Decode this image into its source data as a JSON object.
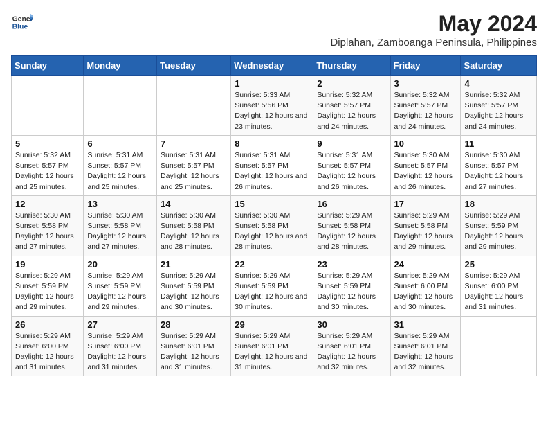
{
  "header": {
    "logo_general": "General",
    "logo_blue": "Blue",
    "month_year": "May 2024",
    "location": "Diplahan, Zamboanga Peninsula, Philippines"
  },
  "weekdays": [
    "Sunday",
    "Monday",
    "Tuesday",
    "Wednesday",
    "Thursday",
    "Friday",
    "Saturday"
  ],
  "weeks": [
    [
      {
        "day": "",
        "sunrise": "",
        "sunset": "",
        "daylight": ""
      },
      {
        "day": "",
        "sunrise": "",
        "sunset": "",
        "daylight": ""
      },
      {
        "day": "",
        "sunrise": "",
        "sunset": "",
        "daylight": ""
      },
      {
        "day": "1",
        "sunrise": "Sunrise: 5:33 AM",
        "sunset": "Sunset: 5:56 PM",
        "daylight": "Daylight: 12 hours and 23 minutes."
      },
      {
        "day": "2",
        "sunrise": "Sunrise: 5:32 AM",
        "sunset": "Sunset: 5:57 PM",
        "daylight": "Daylight: 12 hours and 24 minutes."
      },
      {
        "day": "3",
        "sunrise": "Sunrise: 5:32 AM",
        "sunset": "Sunset: 5:57 PM",
        "daylight": "Daylight: 12 hours and 24 minutes."
      },
      {
        "day": "4",
        "sunrise": "Sunrise: 5:32 AM",
        "sunset": "Sunset: 5:57 PM",
        "daylight": "Daylight: 12 hours and 24 minutes."
      }
    ],
    [
      {
        "day": "5",
        "sunrise": "Sunrise: 5:32 AM",
        "sunset": "Sunset: 5:57 PM",
        "daylight": "Daylight: 12 hours and 25 minutes."
      },
      {
        "day": "6",
        "sunrise": "Sunrise: 5:31 AM",
        "sunset": "Sunset: 5:57 PM",
        "daylight": "Daylight: 12 hours and 25 minutes."
      },
      {
        "day": "7",
        "sunrise": "Sunrise: 5:31 AM",
        "sunset": "Sunset: 5:57 PM",
        "daylight": "Daylight: 12 hours and 25 minutes."
      },
      {
        "day": "8",
        "sunrise": "Sunrise: 5:31 AM",
        "sunset": "Sunset: 5:57 PM",
        "daylight": "Daylight: 12 hours and 26 minutes."
      },
      {
        "day": "9",
        "sunrise": "Sunrise: 5:31 AM",
        "sunset": "Sunset: 5:57 PM",
        "daylight": "Daylight: 12 hours and 26 minutes."
      },
      {
        "day": "10",
        "sunrise": "Sunrise: 5:30 AM",
        "sunset": "Sunset: 5:57 PM",
        "daylight": "Daylight: 12 hours and 26 minutes."
      },
      {
        "day": "11",
        "sunrise": "Sunrise: 5:30 AM",
        "sunset": "Sunset: 5:57 PM",
        "daylight": "Daylight: 12 hours and 27 minutes."
      }
    ],
    [
      {
        "day": "12",
        "sunrise": "Sunrise: 5:30 AM",
        "sunset": "Sunset: 5:58 PM",
        "daylight": "Daylight: 12 hours and 27 minutes."
      },
      {
        "day": "13",
        "sunrise": "Sunrise: 5:30 AM",
        "sunset": "Sunset: 5:58 PM",
        "daylight": "Daylight: 12 hours and 27 minutes."
      },
      {
        "day": "14",
        "sunrise": "Sunrise: 5:30 AM",
        "sunset": "Sunset: 5:58 PM",
        "daylight": "Daylight: 12 hours and 28 minutes."
      },
      {
        "day": "15",
        "sunrise": "Sunrise: 5:30 AM",
        "sunset": "Sunset: 5:58 PM",
        "daylight": "Daylight: 12 hours and 28 minutes."
      },
      {
        "day": "16",
        "sunrise": "Sunrise: 5:29 AM",
        "sunset": "Sunset: 5:58 PM",
        "daylight": "Daylight: 12 hours and 28 minutes."
      },
      {
        "day": "17",
        "sunrise": "Sunrise: 5:29 AM",
        "sunset": "Sunset: 5:58 PM",
        "daylight": "Daylight: 12 hours and 29 minutes."
      },
      {
        "day": "18",
        "sunrise": "Sunrise: 5:29 AM",
        "sunset": "Sunset: 5:59 PM",
        "daylight": "Daylight: 12 hours and 29 minutes."
      }
    ],
    [
      {
        "day": "19",
        "sunrise": "Sunrise: 5:29 AM",
        "sunset": "Sunset: 5:59 PM",
        "daylight": "Daylight: 12 hours and 29 minutes."
      },
      {
        "day": "20",
        "sunrise": "Sunrise: 5:29 AM",
        "sunset": "Sunset: 5:59 PM",
        "daylight": "Daylight: 12 hours and 29 minutes."
      },
      {
        "day": "21",
        "sunrise": "Sunrise: 5:29 AM",
        "sunset": "Sunset: 5:59 PM",
        "daylight": "Daylight: 12 hours and 30 minutes."
      },
      {
        "day": "22",
        "sunrise": "Sunrise: 5:29 AM",
        "sunset": "Sunset: 5:59 PM",
        "daylight": "Daylight: 12 hours and 30 minutes."
      },
      {
        "day": "23",
        "sunrise": "Sunrise: 5:29 AM",
        "sunset": "Sunset: 5:59 PM",
        "daylight": "Daylight: 12 hours and 30 minutes."
      },
      {
        "day": "24",
        "sunrise": "Sunrise: 5:29 AM",
        "sunset": "Sunset: 6:00 PM",
        "daylight": "Daylight: 12 hours and 30 minutes."
      },
      {
        "day": "25",
        "sunrise": "Sunrise: 5:29 AM",
        "sunset": "Sunset: 6:00 PM",
        "daylight": "Daylight: 12 hours and 31 minutes."
      }
    ],
    [
      {
        "day": "26",
        "sunrise": "Sunrise: 5:29 AM",
        "sunset": "Sunset: 6:00 PM",
        "daylight": "Daylight: 12 hours and 31 minutes."
      },
      {
        "day": "27",
        "sunrise": "Sunrise: 5:29 AM",
        "sunset": "Sunset: 6:00 PM",
        "daylight": "Daylight: 12 hours and 31 minutes."
      },
      {
        "day": "28",
        "sunrise": "Sunrise: 5:29 AM",
        "sunset": "Sunset: 6:01 PM",
        "daylight": "Daylight: 12 hours and 31 minutes."
      },
      {
        "day": "29",
        "sunrise": "Sunrise: 5:29 AM",
        "sunset": "Sunset: 6:01 PM",
        "daylight": "Daylight: 12 hours and 31 minutes."
      },
      {
        "day": "30",
        "sunrise": "Sunrise: 5:29 AM",
        "sunset": "Sunset: 6:01 PM",
        "daylight": "Daylight: 12 hours and 32 minutes."
      },
      {
        "day": "31",
        "sunrise": "Sunrise: 5:29 AM",
        "sunset": "Sunset: 6:01 PM",
        "daylight": "Daylight: 12 hours and 32 minutes."
      },
      {
        "day": "",
        "sunrise": "",
        "sunset": "",
        "daylight": ""
      }
    ]
  ]
}
